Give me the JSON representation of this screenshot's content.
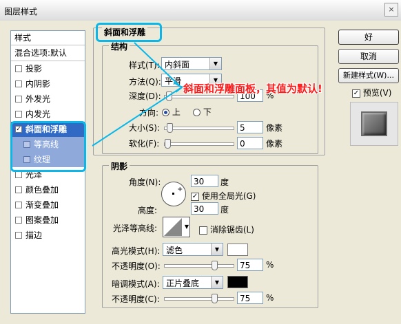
{
  "window": {
    "title": "图层样式",
    "close_label": "×"
  },
  "styles_panel": {
    "header": "样式",
    "blend_options": "混合选项:默认",
    "items": [
      {
        "label": "投影",
        "checked": false
      },
      {
        "label": "内阴影",
        "checked": false
      },
      {
        "label": "外发光",
        "checked": false
      },
      {
        "label": "内发光",
        "checked": false
      },
      {
        "label": "斜面和浮雕",
        "checked": true,
        "selected": true
      },
      {
        "label": "等高线",
        "checked": false,
        "sub": true
      },
      {
        "label": "纹理",
        "checked": false,
        "sub": true
      },
      {
        "label": "光泽",
        "checked": false
      },
      {
        "label": "颜色叠加",
        "checked": false
      },
      {
        "label": "渐变叠加",
        "checked": false
      },
      {
        "label": "图案叠加",
        "checked": false
      },
      {
        "label": "描边",
        "checked": false
      }
    ]
  },
  "bevel": {
    "title": "斜面和浮雕",
    "structure_title": "结构",
    "style_label": "样式(T):",
    "style_value": "内斜面",
    "method_label": "方法(Q):",
    "method_value": "平滑",
    "depth_label": "深度(D):",
    "depth_value": "100",
    "depth_unit": "%",
    "direction_label": "方向:",
    "dir_up": "上",
    "dir_down": "下",
    "direction": "up",
    "size_label": "大小(S):",
    "size_value": "5",
    "size_unit": "像素",
    "soften_label": "软化(F):",
    "soften_value": "0",
    "soften_unit": "像素"
  },
  "shading": {
    "title": "阴影",
    "angle_label": "角度(N):",
    "angle_value": "30",
    "angle_unit": "度",
    "global_light_label": "使用全局光(G)",
    "global_light": true,
    "altitude_label": "高度:",
    "altitude_value": "30",
    "altitude_unit": "度",
    "gloss_label": "光泽等高线:",
    "antialias_label": "消除锯齿(L)",
    "antialias": false,
    "highlight_mode_label": "高光模式(H):",
    "highlight_mode": "滤色",
    "highlight_color": "#ffffff",
    "hl_opacity_label": "不透明度(O):",
    "hl_opacity": "75",
    "hl_unit": "%",
    "shadow_mode_label": "暗调模式(A):",
    "shadow_mode": "正片叠底",
    "shadow_color": "#000000",
    "sh_opacity_label": "不透明度(C):",
    "sh_opacity": "75",
    "sh_unit": "%"
  },
  "buttons": {
    "ok": "好",
    "cancel": "取消",
    "new_style": "新建样式(W)...",
    "preview": "预览(V)",
    "preview_checked": true
  },
  "annotation": {
    "text": "斜面和浮雕面板，其值为默认!",
    "color": "#ff1a1a",
    "arrow_color": "#0bb7e8"
  },
  "sliders": {
    "depth": 0.02,
    "size": 0.03,
    "soften": 0.0,
    "hl_opacity": 0.75,
    "sh_opacity": 0.75
  }
}
